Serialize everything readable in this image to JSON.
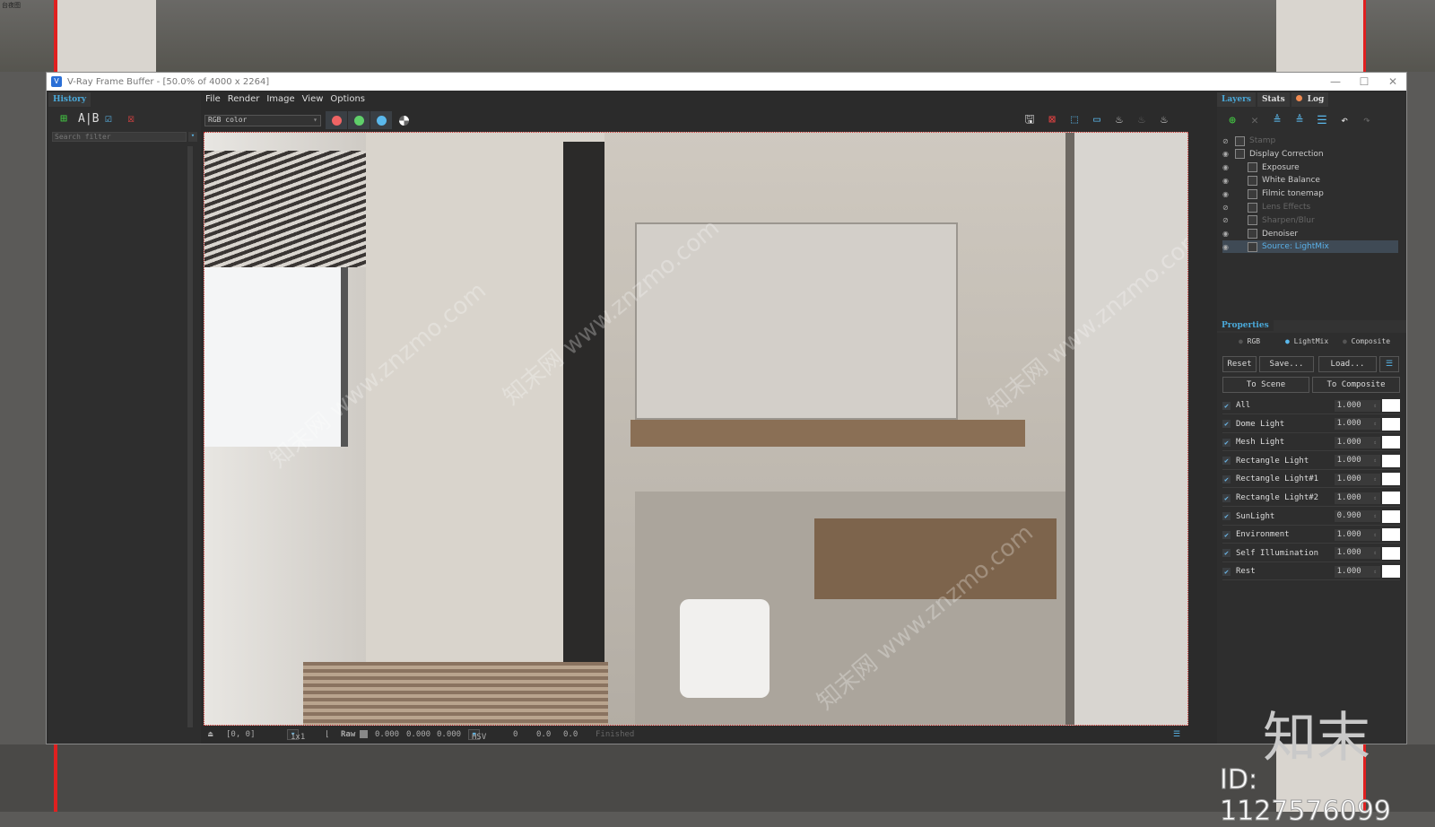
{
  "corner_label": "台夜图",
  "window": {
    "title": "V-Ray Frame Buffer - [50.0% of 4000 x 2264]",
    "minimize": "—",
    "maximize": "☐",
    "close": "✕"
  },
  "history": {
    "tab": "History",
    "search_placeholder": "Search filter"
  },
  "menu": [
    "File",
    "Render",
    "Image",
    "View",
    "Options"
  ],
  "toolbar": {
    "channel": "RGB color",
    "colors": {
      "red": "#ef6464",
      "green": "#5fcf6a",
      "blue": "#5ab8ec"
    }
  },
  "right_tabs": {
    "layers": "Layers",
    "stats": "Stats",
    "log": "Log",
    "log_dot": "#f08a50"
  },
  "layers": [
    {
      "name": "Stamp",
      "enabled": false,
      "indent": 0
    },
    {
      "name": "Display Correction",
      "enabled": true,
      "indent": 0
    },
    {
      "name": "Exposure",
      "enabled": true,
      "indent": 1
    },
    {
      "name": "White Balance",
      "enabled": true,
      "indent": 1
    },
    {
      "name": "Filmic tonemap",
      "enabled": true,
      "indent": 1
    },
    {
      "name": "Lens Effects",
      "enabled": false,
      "indent": 1
    },
    {
      "name": "Sharpen/Blur",
      "enabled": false,
      "indent": 1
    },
    {
      "name": "Denoiser",
      "enabled": true,
      "indent": 1
    },
    {
      "name": "Source: LightMix",
      "enabled": true,
      "indent": 1,
      "selected": true
    }
  ],
  "properties": {
    "title": "Properties",
    "modes": [
      "RGB",
      "LightMix",
      "Composite"
    ],
    "selected_mode": "LightMix",
    "reset": "Reset",
    "save": "Save...",
    "load": "Load...",
    "to_scene": "To Scene",
    "to_composite": "To Composite",
    "lights": [
      {
        "name": "All",
        "value": "1.000"
      },
      {
        "name": "Dome Light",
        "value": "1.000"
      },
      {
        "name": "Mesh Light",
        "value": "1.000"
      },
      {
        "name": "Rectangle Light",
        "value": "1.000"
      },
      {
        "name": "Rectangle Light#1",
        "value": "1.000"
      },
      {
        "name": "Rectangle Light#2",
        "value": "1.000"
      },
      {
        "name": "SunLight",
        "value": "0.900"
      },
      {
        "name": "Environment",
        "value": "1.000"
      },
      {
        "name": "Self Illumination",
        "value": "1.000"
      },
      {
        "name": "Rest",
        "value": "1.000"
      }
    ]
  },
  "status": {
    "coords": "[0,  0]",
    "zoom": "1x1",
    "raw": "Raw",
    "r": "0.000",
    "g": "0.000",
    "b": "0.000",
    "space": "HSV",
    "h": "0",
    "s": "0.0",
    "v": "0.0",
    "state": "Finished"
  },
  "watermark": {
    "brand": "知末",
    "id": "ID: 1127576099",
    "site": "知末网 www.znzmo.com"
  }
}
